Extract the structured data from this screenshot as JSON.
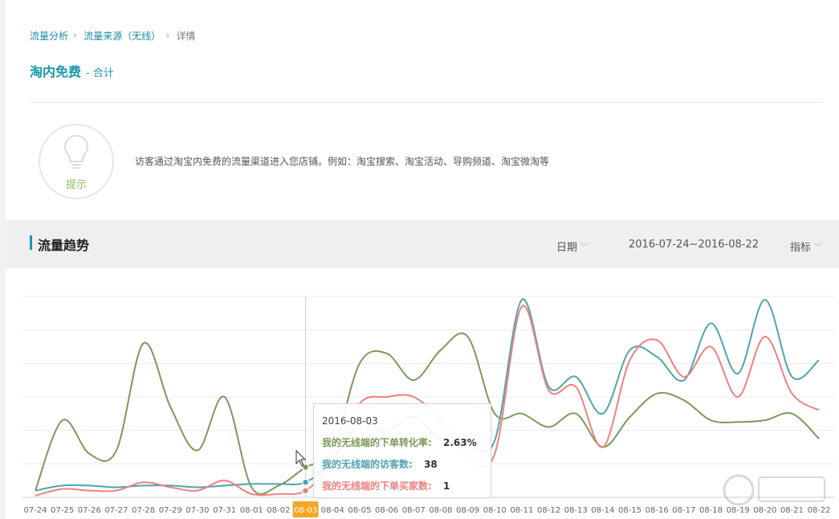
{
  "breadcrumb": {
    "items": [
      "流量分析",
      "流量来源（无线）"
    ],
    "current": "详情"
  },
  "page": {
    "title": "淘内免费",
    "subtitle": "- 合计"
  },
  "tip": {
    "label": "提示",
    "text": "访客通过淘宝内免费的流量渠道进入您店铺。例如：淘宝搜索、淘宝活动、导购频道、淘宝微淘等"
  },
  "trend": {
    "title": "流量趋势",
    "date_label": "日期",
    "date_range": "2016-07-24~2016-08-22",
    "metric_label": "指标"
  },
  "tooltip": {
    "date": "2016-08-03",
    "rows": [
      {
        "label": "我的无线端的下单转化率:",
        "value": "2.63%",
        "color": "#7b9a5a"
      },
      {
        "label": "我的无线端的访客数:",
        "value": "38",
        "color": "#4fa3ad"
      },
      {
        "label": "我的无线端的下单买家数:",
        "value": "1",
        "color": "#f08080"
      }
    ]
  },
  "chart_data": {
    "type": "line",
    "categories": [
      "07-24",
      "07-25",
      "07-26",
      "07-27",
      "07-28",
      "07-29",
      "07-30",
      "07-31",
      "08-01",
      "08-02",
      "08-03",
      "08-04",
      "08-05",
      "08-06",
      "08-07",
      "08-08",
      "08-09",
      "08-10",
      "08-11",
      "08-12",
      "08-13",
      "08-14",
      "08-15",
      "08-16",
      "08-17",
      "08-18",
      "08-19",
      "08-20",
      "08-21",
      "08-22"
    ],
    "highlight_category": "08-03",
    "ylim": [
      0,
      6
    ],
    "grid": true,
    "series": [
      {
        "name": "我的无线端的下单转化率",
        "color": "#7b9a5a",
        "values": [
          0.2,
          2.3,
          1.3,
          1.4,
          4.6,
          2.7,
          1.4,
          3.0,
          0.3,
          0.35,
          0.9,
          1.4,
          4.0,
          4.3,
          3.5,
          4.4,
          4.8,
          2.5,
          2.5,
          2.1,
          2.5,
          1.5,
          2.4,
          3.1,
          2.9,
          2.3,
          2.25,
          2.3,
          2.5,
          1.75
        ]
      },
      {
        "name": "我的无线端的访客数",
        "color": "#4fa3ad",
        "values": [
          0.2,
          0.35,
          0.35,
          0.3,
          0.35,
          0.35,
          0.3,
          0.35,
          0.4,
          0.4,
          0.45,
          1.1,
          2.2,
          2.0,
          2.4,
          1.7,
          1.6,
          1.7,
          5.9,
          3.3,
          3.6,
          2.5,
          4.4,
          4.2,
          3.5,
          5.2,
          3.7,
          5.9,
          3.6,
          4.1
        ]
      },
      {
        "name": "我的无线端的下单买家数",
        "color": "#f08080",
        "values": [
          0.05,
          0.25,
          0.2,
          0.2,
          0.45,
          0.3,
          0.2,
          0.5,
          0.1,
          0.1,
          0.2,
          1.1,
          2.8,
          3.0,
          3.0,
          2.3,
          1.2,
          1.3,
          5.7,
          3.2,
          3.3,
          1.5,
          4.1,
          4.7,
          3.6,
          4.5,
          3.0,
          4.8,
          3.1,
          2.6
        ]
      }
    ]
  }
}
